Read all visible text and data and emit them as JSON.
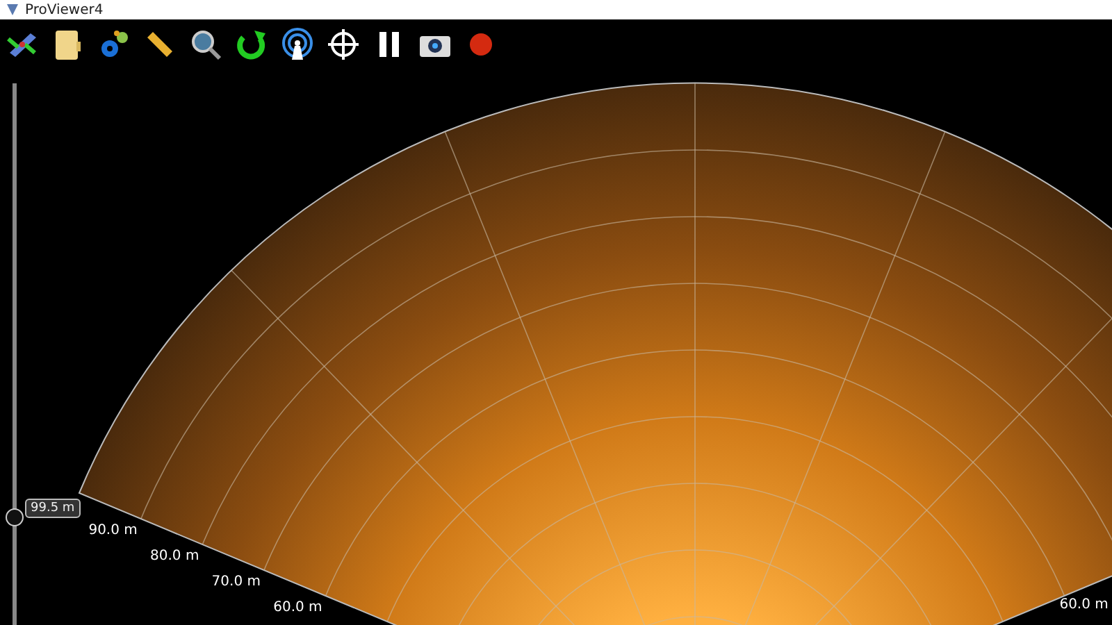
{
  "window": {
    "title": "ProViewer4"
  },
  "toolbar": {
    "recording": true
  },
  "range_slider": {
    "level": 0.2,
    "reading": "99.5 m"
  },
  "sonar": {
    "left_range_labels": [
      "90.0 m",
      "80.0 m",
      "70.0 m",
      "60.0 m"
    ],
    "right_range_labels": [
      "60.0 m"
    ]
  }
}
